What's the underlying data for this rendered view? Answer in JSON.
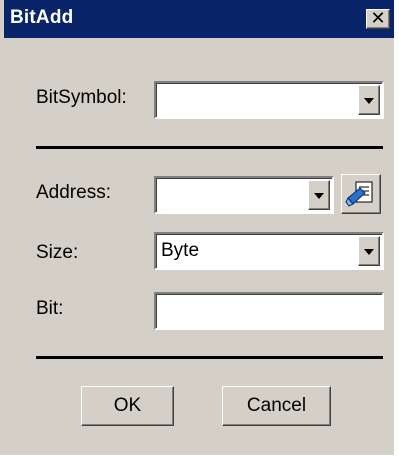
{
  "window": {
    "title": "BitAdd",
    "close_glyph": "✕"
  },
  "form": {
    "bit_symbol": {
      "label": "BitSymbol:",
      "value": ""
    },
    "address": {
      "label": "Address:",
      "value": ""
    },
    "size": {
      "label": "Size:",
      "value": "Byte"
    },
    "bit": {
      "label": "Bit:",
      "value": ""
    }
  },
  "buttons": {
    "ok": "OK",
    "cancel": "Cancel"
  },
  "colors": {
    "titlebar": "#0a246a",
    "face": "#d4d0c8",
    "browse_icon": "#2a6fc9"
  },
  "icons": {
    "dropdown": "chevron-down-icon",
    "browse": "address-browse-icon"
  }
}
